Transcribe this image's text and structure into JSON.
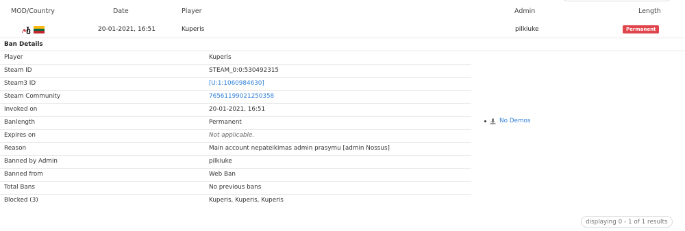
{
  "table": {
    "headers": {
      "mod_country": "MOD/Country",
      "date": "Date",
      "player": "Player",
      "admin": "Admin",
      "length": "Length"
    },
    "row": {
      "date": "20-01-2021, 16:51",
      "player": "Kuperis",
      "admin": "pilkiuke",
      "length_badge": "Permanent"
    }
  },
  "details": {
    "title": "Ban Details",
    "rows": [
      {
        "label": "Player",
        "value": "Kuperis"
      },
      {
        "label": "Steam ID",
        "value": "STEAM_0:0:530492315"
      },
      {
        "label": "Steam3 ID",
        "value": "[U:1:1060984630]"
      },
      {
        "label": "Steam Community",
        "value": "76561199021250358"
      },
      {
        "label": "Invoked on",
        "value": "20-01-2021, 16:51"
      },
      {
        "label": "Banlength",
        "value": "Permanent"
      },
      {
        "label": "Expires on",
        "value": "Not applicable."
      },
      {
        "label": "Reason",
        "value": "Main account nepateikimas admin prasymu [admin Nossus]"
      },
      {
        "label": "Banned by Admin",
        "value": "pilkiuke"
      },
      {
        "label": "Banned from",
        "value": "Web Ban"
      },
      {
        "label": "Total Bans",
        "value": "No previous bans"
      },
      {
        "label": "Blocked (3)",
        "value": "Kuperis, Kuperis, Kuperis"
      }
    ],
    "demos": "No Demos"
  },
  "pagination": {
    "text": "displaying 0 - 1 of 1 results"
  },
  "colors": {
    "badge_red": "#e0454b",
    "link_blue": "#2f7fd6",
    "flag_yellow": "#fdb913",
    "flag_green": "#006a44",
    "flag_red": "#c1272d"
  },
  "icons": {
    "mod": "sourcebans-logo-icon",
    "country": "lithuania-flag-icon",
    "demo": "demo-icon"
  }
}
